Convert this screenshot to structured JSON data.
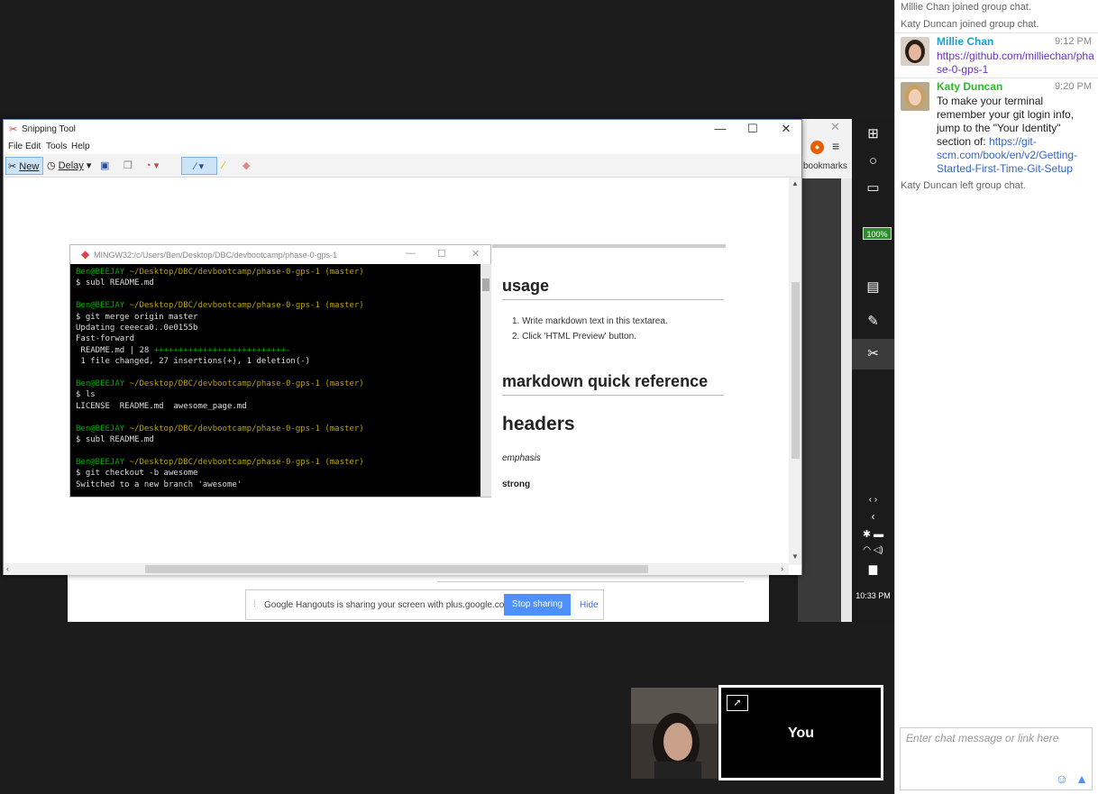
{
  "snipping_tool": {
    "title": "Snipping Tool",
    "menu": [
      "File",
      "Edit",
      "Tools",
      "Help"
    ],
    "new_label": "New",
    "delay_label": "Delay"
  },
  "terminal": {
    "title": "MINGW32:/c/Users/Ben/Desktop/DBC/devbootcamp/phase-0-gps-1",
    "prompt_user": "Ben@BEEJAY",
    "prompt_path": "~/Desktop/DBC/devbootcamp/phase-0-gps-1 (master)",
    "lines": {
      "c1": "$ subl README.md",
      "c2": "$ git merge origin master",
      "o2a": "Updating ceeeca0..0e0155b",
      "o2b": "Fast-forward",
      "o2c": " README.md | 28 ",
      "o2c_plus": "+++++++++++++++++++++++++++-",
      "o2d": " 1 file changed, 27 insertions(+), 1 deletion(-)",
      "c3": "$ ls",
      "o3": "LICENSE  README.md  awesome_page.md",
      "c4": "$ subl README.md",
      "c5": "$ git checkout -b awesome",
      "o5": "Switched to a new branch 'awesome'"
    }
  },
  "markdown": {
    "h_usage": "usage",
    "li1": "1. Write markdown text in this textarea.",
    "li2": "2. Click 'HTML Preview' button.",
    "h_quickref": "markdown quick reference",
    "h_headers": "headers",
    "emphasis": "emphasis",
    "strong": "strong"
  },
  "browser_under": {
    "bookmarks": "bookmarks"
  },
  "taskbar": {
    "battery": "100%",
    "clock": "10:33 PM"
  },
  "hangouts_bar": {
    "message": "Google Hangouts is sharing your screen with plus.google.com.",
    "stop_label": "Stop sharing",
    "hide_label": "Hide"
  },
  "video": {
    "you_label": "You"
  },
  "chat": {
    "system": {
      "s1": "Millie Chan joined group chat.",
      "s2": "Katy Duncan joined group chat.",
      "s3": "Katy Duncan left group chat."
    },
    "messages": [
      {
        "sender": "Millie Chan",
        "time": "9:12 PM",
        "text": "https://github.com/milliechan/phase-0-gps-1",
        "color": "#1aa0c8"
      },
      {
        "sender": "Katy Duncan",
        "time": "9:20 PM",
        "text_prefix": "To make your terminal remember your git login info, jump to the \"Your Identity\" section of: ",
        "link": "https://git-scm.com/book/en/v2/Getting-Started-First-Time-Git-Setup",
        "color": "#2db82d"
      }
    ],
    "input_placeholder": "Enter chat message or link here"
  }
}
